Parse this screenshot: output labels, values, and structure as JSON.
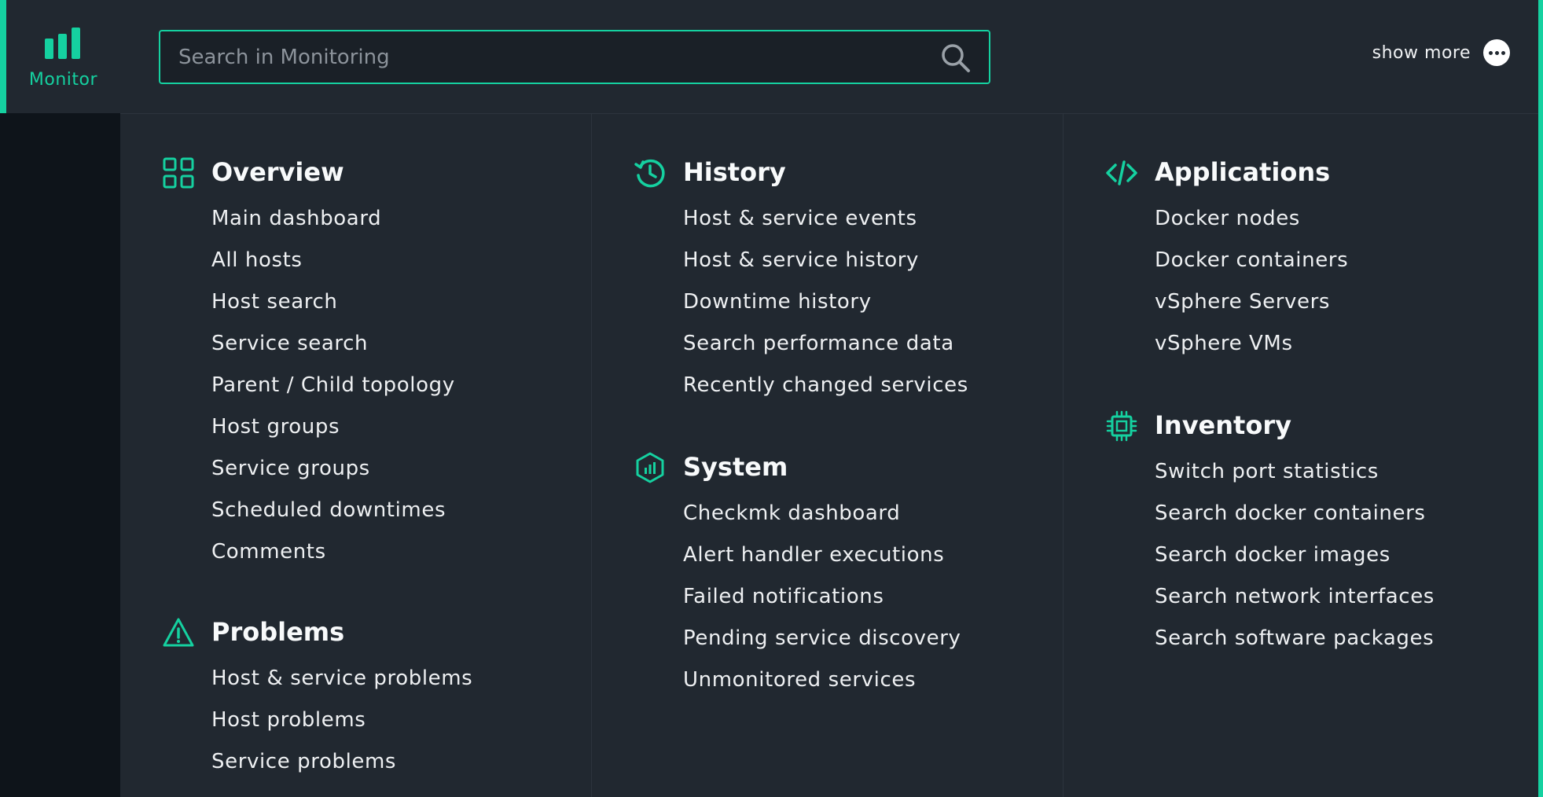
{
  "sidebar": {
    "active_label": "Monitor"
  },
  "search": {
    "placeholder": "Search in Monitoring"
  },
  "show_more_label": "show more",
  "colors": {
    "accent": "#15d1a0",
    "panel_bg": "#212830",
    "sidebar_bg": "#0e141a"
  },
  "topics": {
    "overview": {
      "title": "Overview",
      "icon": "grid-icon",
      "items": [
        "Main dashboard",
        "All hosts",
        "Host search",
        "Service search",
        "Parent / Child topology",
        "Host groups",
        "Service groups",
        "Scheduled downtimes",
        "Comments"
      ]
    },
    "problems": {
      "title": "Problems",
      "icon": "warning-icon",
      "items": [
        "Host & service problems",
        "Host problems",
        "Service problems"
      ]
    },
    "history": {
      "title": "History",
      "icon": "history-icon",
      "items": [
        "Host & service events",
        "Host & service history",
        "Downtime history",
        "Search performance data",
        "Recently changed services"
      ]
    },
    "system": {
      "title": "System",
      "icon": "hexagon-chart-icon",
      "items": [
        "Checkmk dashboard",
        "Alert handler executions",
        "Failed notifications",
        "Pending service discovery",
        "Unmonitored services"
      ]
    },
    "applications": {
      "title": "Applications",
      "icon": "code-icon",
      "items": [
        "Docker nodes",
        "Docker containers",
        "vSphere Servers",
        "vSphere VMs"
      ]
    },
    "inventory": {
      "title": "Inventory",
      "icon": "chip-icon",
      "items": [
        "Switch port statistics",
        "Search docker containers",
        "Search docker images",
        "Search network interfaces",
        "Search software packages"
      ]
    }
  }
}
